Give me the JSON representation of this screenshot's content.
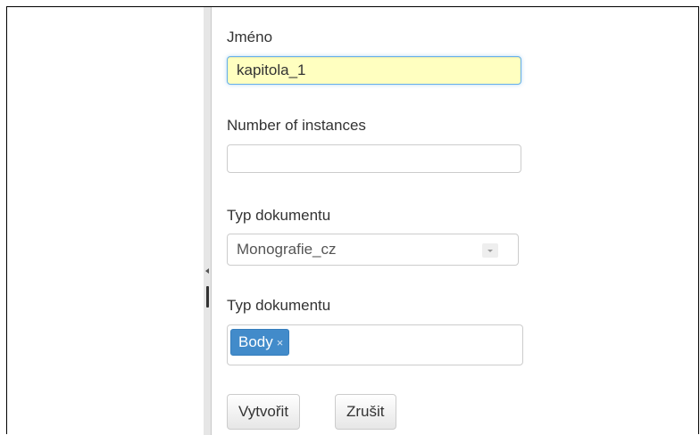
{
  "form": {
    "name_label": "Jméno",
    "name_value": "kapitola_1",
    "instances_label": "Number of instances",
    "instances_value": "",
    "doc_type_label": "Typ dokumentu",
    "doc_type_selected": "Monografie_cz",
    "doc_type2_label": "Typ dokumentu",
    "doc_type2_tags": [
      "Body"
    ],
    "tag_remove_glyph": "×",
    "create_button": "Vytvořit",
    "cancel_button": "Zrušit"
  },
  "colors": {
    "highlight_field": "#ffffc0",
    "tag_background": "#428bca"
  }
}
